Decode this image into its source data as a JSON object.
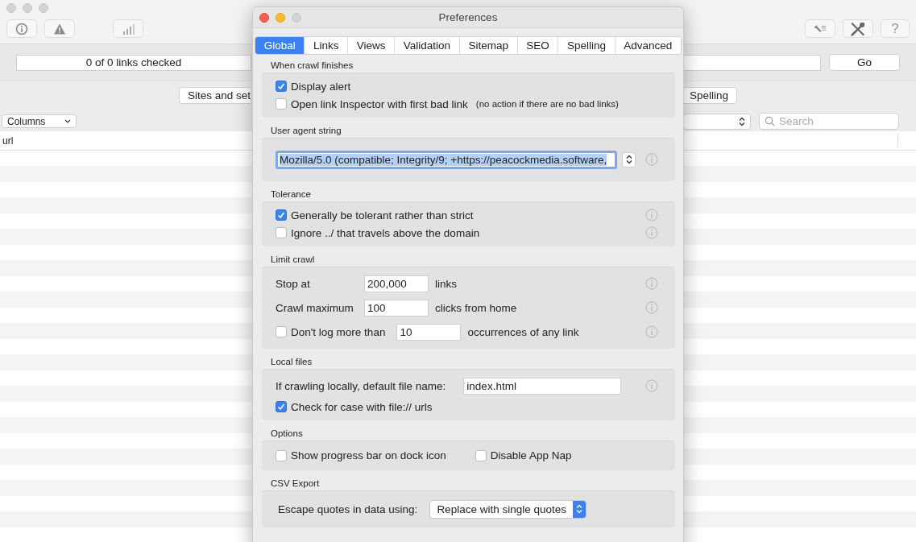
{
  "main_window": {
    "progress": "0 of 0 links checked",
    "go_button": "Go",
    "help_button": "?",
    "tabs": [
      {
        "label": "Sites and set",
        "selected": false
      },
      {
        "label": "Spelling",
        "selected": false
      }
    ],
    "columns_menu": "Columns",
    "search": {
      "placeholder": "Search"
    },
    "table": {
      "columns": [
        "url"
      ]
    }
  },
  "dialog": {
    "title": "Preferences",
    "tabs": [
      {
        "label": "Global",
        "selected": true
      },
      {
        "label": "Links",
        "selected": false
      },
      {
        "label": "Views",
        "selected": false
      },
      {
        "label": "Validation",
        "selected": false
      },
      {
        "label": "Sitemap",
        "selected": false
      },
      {
        "label": "SEO",
        "selected": false
      },
      {
        "label": "Spelling",
        "selected": false
      },
      {
        "label": "Advanced",
        "selected": false
      }
    ],
    "sections": [
      {
        "title": "When crawl finishes",
        "rows": [
          {
            "kind": "checkbox",
            "label": "Display alert",
            "checked": true
          },
          {
            "kind": "checkbox",
            "label": "Open link Inspector with first bad link",
            "note": "(no action if there are no bad links)",
            "checked": false
          }
        ]
      },
      {
        "title": "User agent string",
        "rows": [
          {
            "kind": "combo",
            "value": "Mozilla/5.0 (compatible; Integrity/9; +https://peacockmedia.software,",
            "info": true
          }
        ]
      },
      {
        "title": "Tolerance",
        "rows": [
          {
            "kind": "checkbox",
            "label": "Generally be tolerant rather than strict",
            "checked": true,
            "info": true
          },
          {
            "kind": "checkbox",
            "label": "Ignore ../ that travels above the domain",
            "checked": false,
            "info": true
          }
        ]
      },
      {
        "title": "Limit crawl",
        "rows": [
          {
            "kind": "field",
            "label": "Stop at",
            "value": "200,000",
            "unit": "links",
            "info": true
          },
          {
            "kind": "field",
            "label": "Crawl maximum",
            "value": "100",
            "unit": "clicks from home",
            "info": true
          },
          {
            "kind": "checkfield",
            "label": "Don't log more than",
            "checked": false,
            "value": "10",
            "unit": "occurrences of any link",
            "info": true
          }
        ]
      },
      {
        "title": "Local files",
        "rows": [
          {
            "kind": "field",
            "label": "If crawling locally, default file name:",
            "value": "index.html",
            "info": true
          },
          {
            "kind": "checkbox",
            "label": "Check for case with file:// urls",
            "checked": true
          }
        ]
      },
      {
        "title": "Options",
        "rows": [
          {
            "kind": "inline",
            "items": [
              {
                "label": "Show progress bar on dock icon",
                "checked": false
              },
              {
                "label": "Disable App Nap",
                "checked": false
              }
            ]
          }
        ]
      },
      {
        "title": "CSV Export",
        "rows": [
          {
            "kind": "popup",
            "label": "Escape quotes in data using:",
            "value": "Replace with single quotes"
          }
        ]
      }
    ]
  }
}
